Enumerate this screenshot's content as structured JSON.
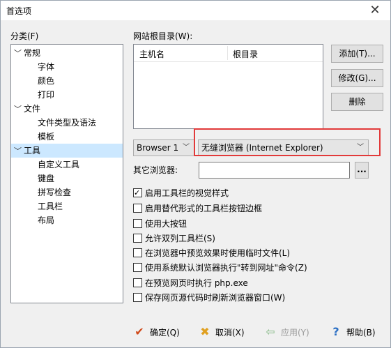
{
  "window": {
    "title": "首选项",
    "close_glyph": "✕"
  },
  "category": {
    "label": "分类(F)",
    "items": [
      {
        "label": "常规",
        "level": 0,
        "expanded": true
      },
      {
        "label": "字体",
        "level": 1
      },
      {
        "label": "颜色",
        "level": 1
      },
      {
        "label": "打印",
        "level": 1
      },
      {
        "label": "文件",
        "level": 0,
        "expanded": true
      },
      {
        "label": "文件类型及语法",
        "level": 1
      },
      {
        "label": "模板",
        "level": 1
      },
      {
        "label": "工具",
        "level": 0,
        "expanded": true,
        "selected": true
      },
      {
        "label": "自定义工具",
        "level": 1
      },
      {
        "label": "键盘",
        "level": 1
      },
      {
        "label": "拼写检查",
        "level": 1
      },
      {
        "label": "工具栏",
        "level": 1
      },
      {
        "label": "布局",
        "level": 1
      }
    ]
  },
  "site_root": {
    "label": "网站根目录(W):",
    "columns": [
      "主机名",
      "根目录"
    ],
    "add_button": "添加(T)...",
    "edit_button": "修改(G)...",
    "delete_button": "删除"
  },
  "browser": {
    "selector": "Browser 1",
    "engine": "无缝浏览器 (Internet Explorer)",
    "other_label": "其它浏览器:",
    "other_value": "",
    "browse_button": "..."
  },
  "options": [
    {
      "label": "启用工具栏的视觉样式",
      "checked": true
    },
    {
      "label": "启用替代形式的工具栏按钮边框",
      "checked": false
    },
    {
      "label": "使用大按钮",
      "checked": false
    },
    {
      "label": "允许双列工具栏(S)",
      "checked": false
    },
    {
      "label": "在浏览器中预览效果时使用临时文件(L)",
      "checked": false
    },
    {
      "label": "使用系统默认浏览器执行\"转到网址\"命令(Z)",
      "checked": false
    },
    {
      "label": "在预览网页时执行 php.exe",
      "checked": false
    },
    {
      "label": "保存网页源代码时刷新浏览器窗口(W)",
      "checked": false
    }
  ],
  "footer": {
    "ok": "确定(Q)",
    "cancel": "取消(X)",
    "apply": "应用(Y)",
    "help": "帮助(B)"
  },
  "colors": {
    "ok_icon": "#d04a1a",
    "cancel_icon": "#e0a020",
    "apply_icon": "#9fc69f",
    "help_icon": "#2b6fc4",
    "highlight": "#e23a3a"
  }
}
